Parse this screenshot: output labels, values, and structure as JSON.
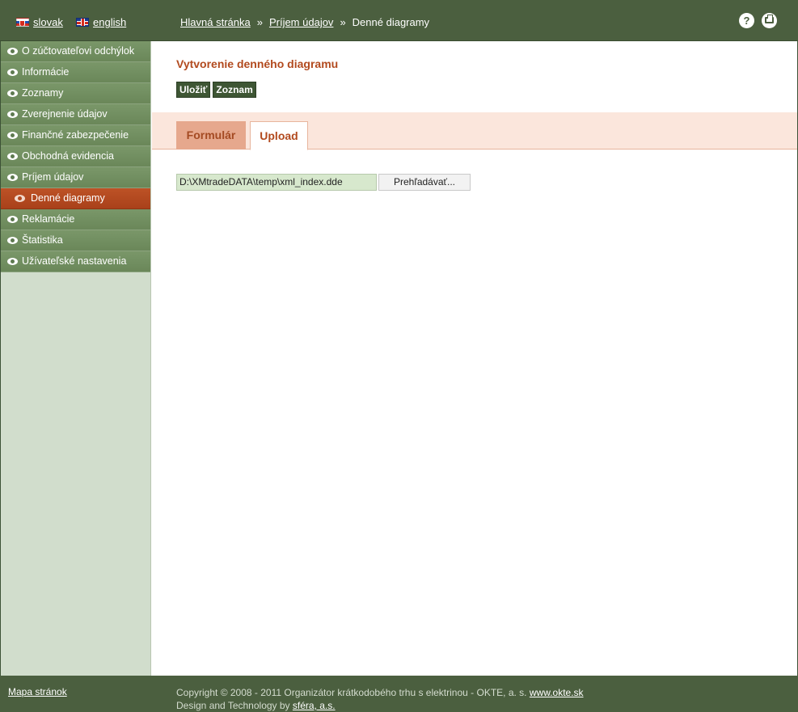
{
  "header": {
    "languages": [
      {
        "label": "slovak",
        "flag": "sk-flag"
      },
      {
        "label": "english",
        "flag": "gb-flag"
      }
    ],
    "breadcrumb": [
      {
        "label": "Hlavná stránka"
      },
      {
        "label": "Príjem údajov"
      },
      {
        "label": "Denné diagramy"
      }
    ],
    "separator": "»",
    "help_icon": "?",
    "icons": [
      "help-icon",
      "print-icon"
    ]
  },
  "sidebar": {
    "items": [
      {
        "label": "O zúčtovateľovi odchýlok"
      },
      {
        "label": "Informácie"
      },
      {
        "label": "Zoznamy"
      },
      {
        "label": "Zverejnenie údajov"
      },
      {
        "label": "Finančné zabezpečenie"
      },
      {
        "label": "Obchodná evidencia"
      },
      {
        "label": "Príjem údajov"
      },
      {
        "label": "Denné diagramy",
        "active": true
      },
      {
        "label": "Reklamácie"
      },
      {
        "label": "Štatistika"
      },
      {
        "label": "Užívateľské nastavenia"
      }
    ]
  },
  "main": {
    "title": "Vytvorenie denného diagramu",
    "buttons": {
      "save": "Uložiť",
      "list": "Zoznam"
    },
    "tabs": [
      {
        "label": "Formulár"
      },
      {
        "label": "Upload",
        "active": true
      }
    ],
    "file_input_value": "D:\\XMtradeDATA\\temp\\xml_index.dde",
    "browse_label": "Prehľadávať..."
  },
  "footer": {
    "sitemap": "Mapa stránok",
    "copyright": "Copyright © 2008 - 2011 Organizátor krátkodobého trhu s elektrinou - OKTE, a. s.",
    "copyright_link": "www.okte.sk",
    "design": "Design and Technology by",
    "design_link": "sféra, a.s."
  },
  "colors": {
    "header_green": "#4b5f3f",
    "nav_green": "#6f8c61",
    "active_orange": "#b3491f",
    "title_orange": "#b24a1e"
  }
}
